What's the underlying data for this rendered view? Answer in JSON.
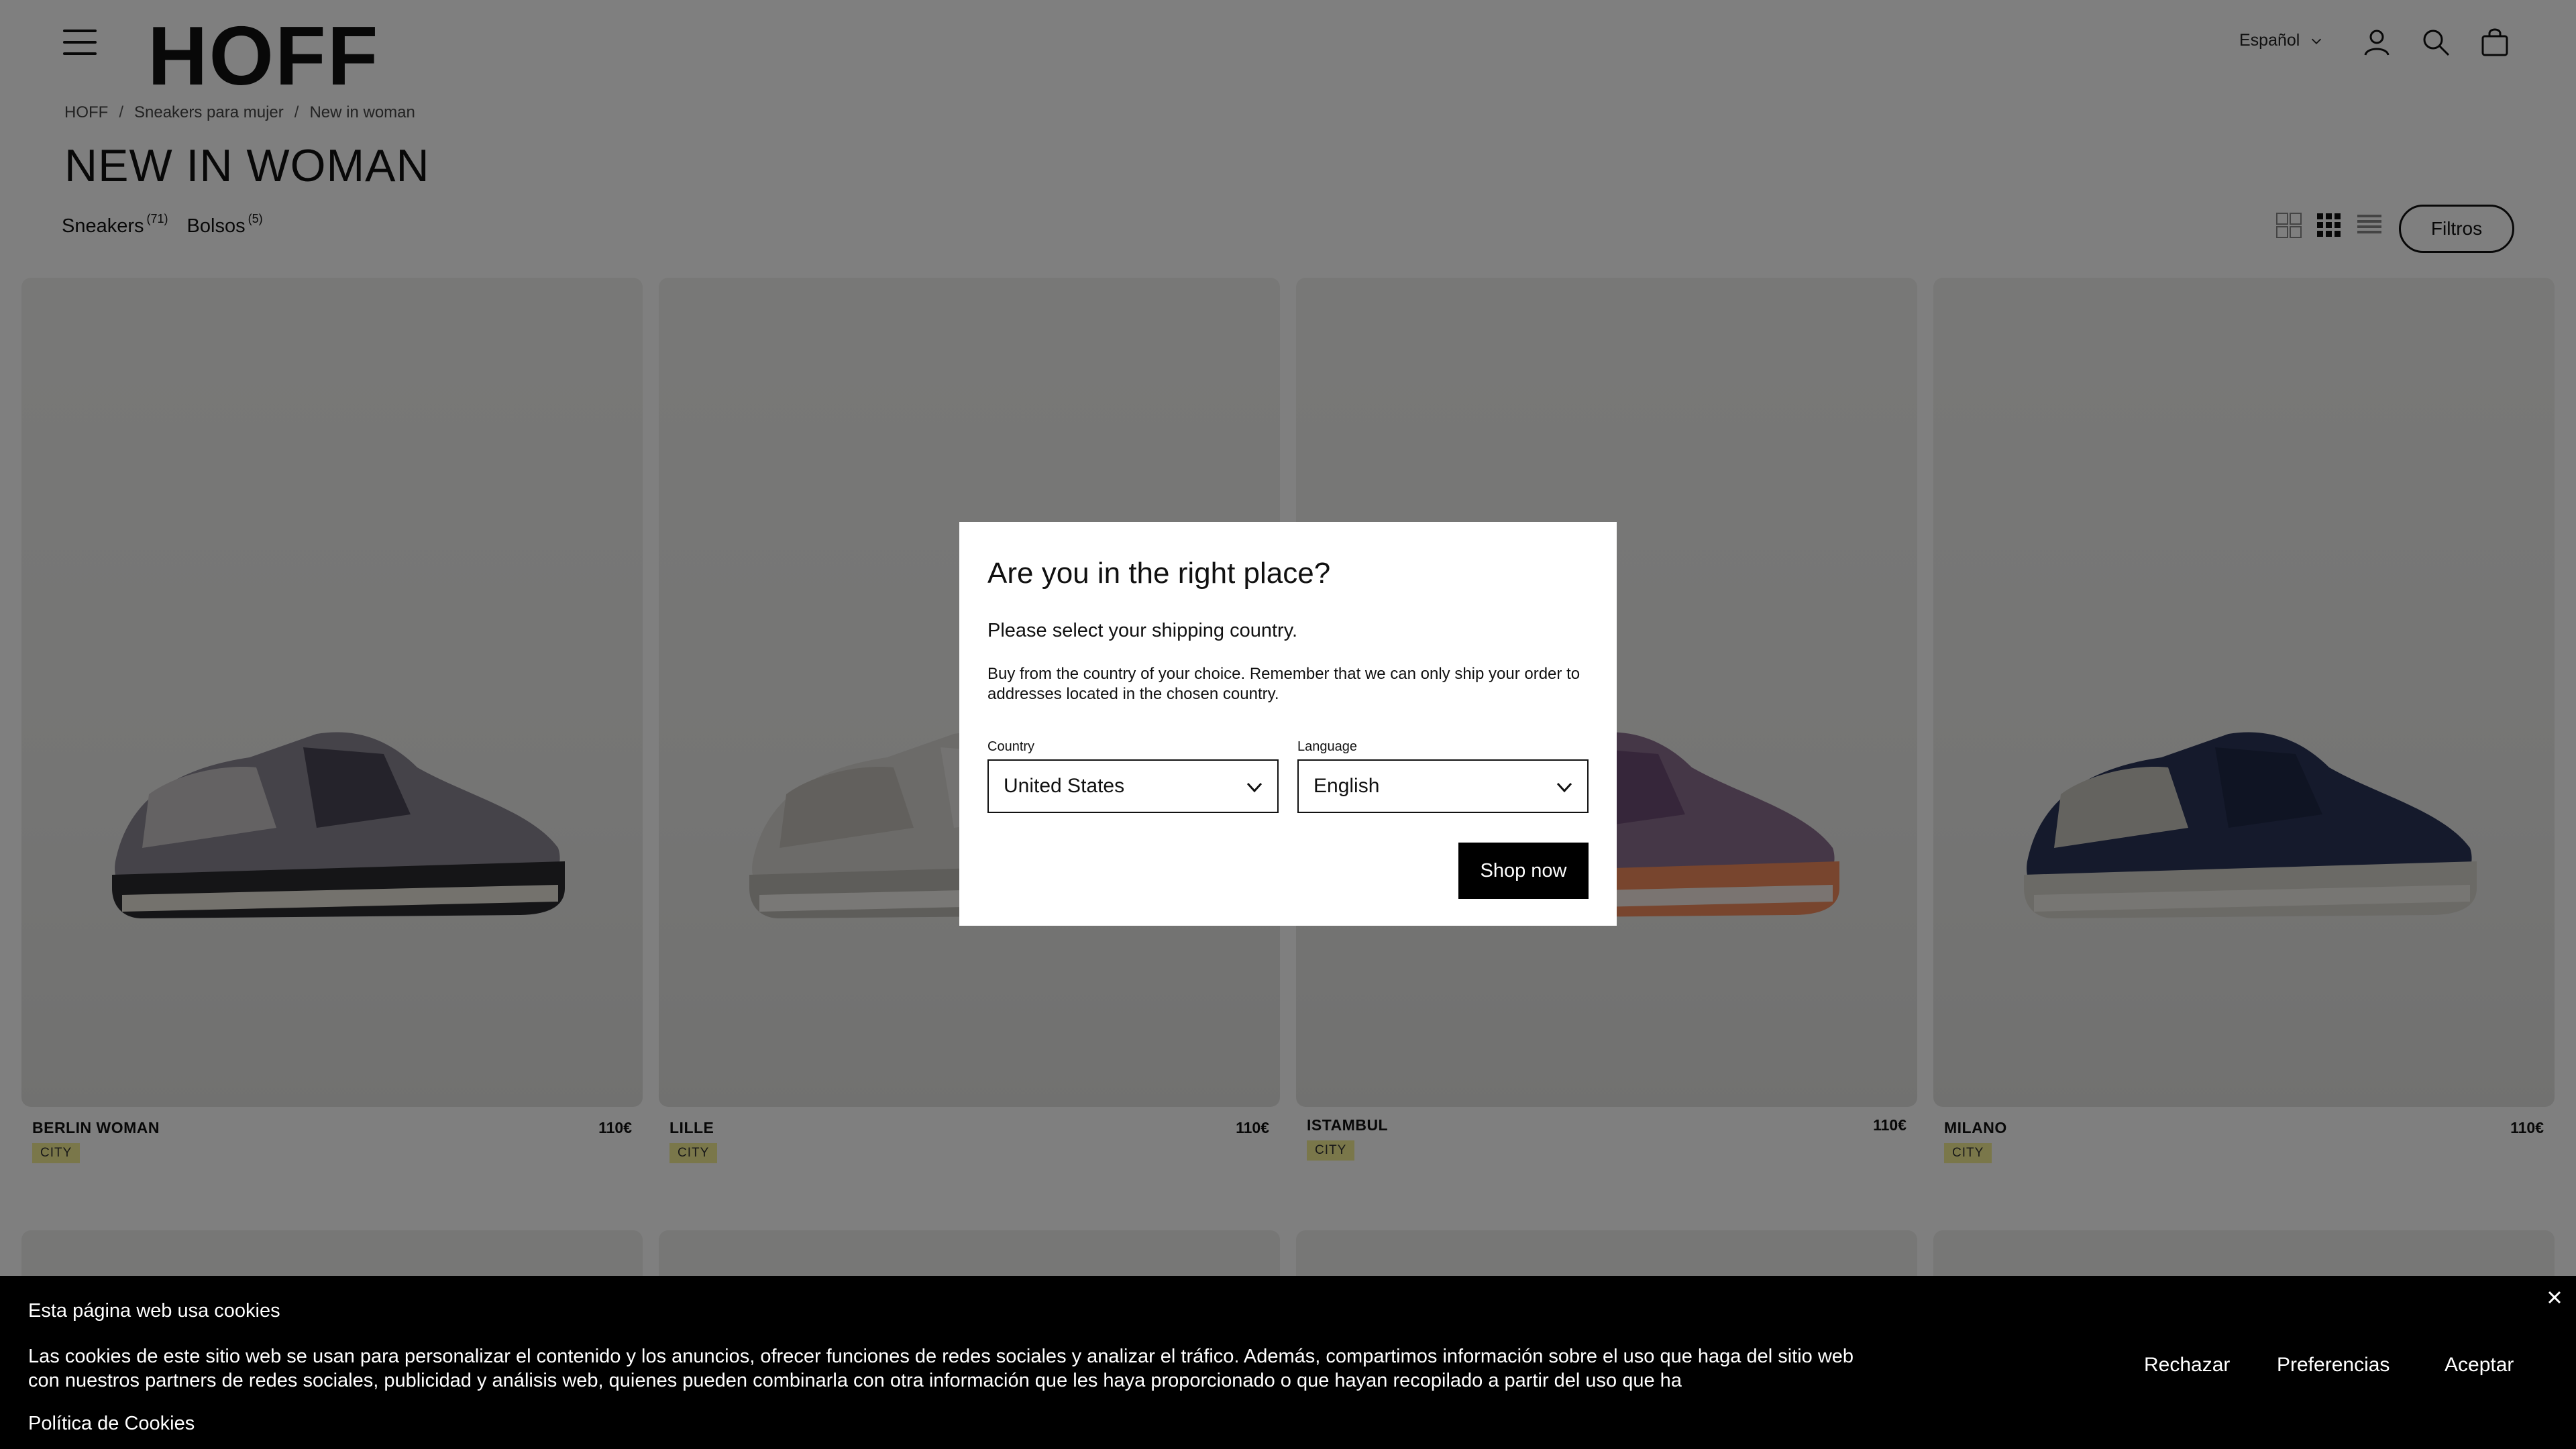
{
  "header": {
    "logo": "HOFF",
    "language": "Español"
  },
  "breadcrumb": [
    "HOFF",
    "Sneakers para mujer",
    "New in woman"
  ],
  "page_title": "NEW IN WOMAN",
  "categories": [
    {
      "label": "Sneakers",
      "count": "(71)"
    },
    {
      "label": "Bolsos",
      "count": "(5)"
    }
  ],
  "filters_label": "Filtros",
  "products": [
    {
      "name": "BERLIN WOMAN",
      "price": "110€",
      "badge": "CITY",
      "colors": {
        "upper": "#8a8693",
        "suede": "#c8c4c6",
        "accent": "#4a4756",
        "sole": "#2a2a2e"
      }
    },
    {
      "name": "LILLE",
      "price": "110€",
      "badge": "CITY",
      "colors": {
        "upper": "#d9d7d2",
        "suede": "#c4c1bb",
        "accent": "#e8e7e4",
        "sole": "#bdbab4"
      }
    },
    {
      "name": "ISTAMBUL",
      "price": "110€",
      "badge": "CITY",
      "colors": {
        "upper": "#8b6e8e",
        "suede": "#d4bcc1",
        "accent": "#6c4c74",
        "sole": "#f08a5d"
      }
    },
    {
      "name": "MILANO",
      "price": "110€",
      "badge": "CITY",
      "colors": {
        "upper": "#2b3558",
        "suede": "#c9c6bf",
        "accent": "#1f2847",
        "sole": "#d7d4cc"
      }
    }
  ],
  "modal": {
    "title": "Are you in the right place?",
    "subtitle": "Please select your shipping country.",
    "description": "Buy from the country of your choice. Remember that we can only ship your order to addresses located in the chosen country.",
    "country_label": "Country",
    "country_value": "United States",
    "language_label": "Language",
    "language_value": "English",
    "shop_button": "Shop now"
  },
  "cookie": {
    "title": "Esta página web usa cookies",
    "text": "Las cookies de este sitio web se usan para personalizar el contenido y los anuncios, ofrecer funciones de redes sociales y analizar el tráfico. Además, compartimos información sobre el uso que haga del sitio web con nuestros partners de redes sociales, publicidad y análisis web, quienes pueden combinarla con otra información que les haya proporcionado o que hayan recopilado a partir del uso que ha",
    "policy_link": "Política de Cookies",
    "reject": "Rechazar",
    "preferences": "Preferencias",
    "accept": "Aceptar"
  }
}
